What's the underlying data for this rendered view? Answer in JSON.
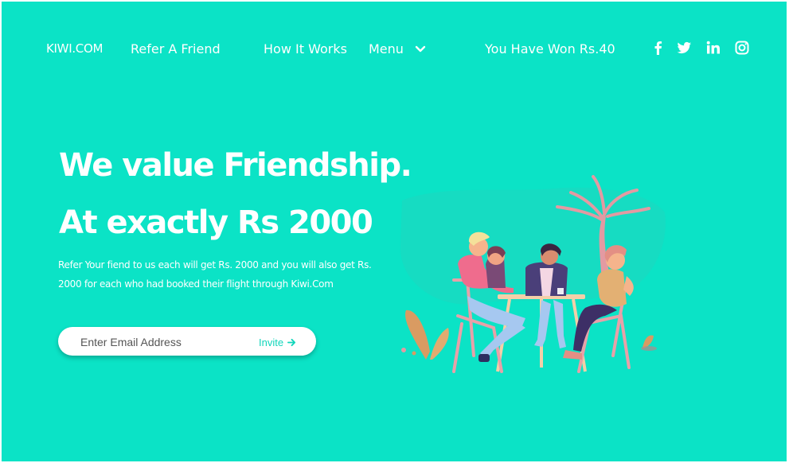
{
  "nav": {
    "brand": "KIWI.COM",
    "refer": "Refer A Friend",
    "how": "How It Works",
    "menu": "Menu",
    "won": "You Have Won Rs.40"
  },
  "social": [
    "facebook-icon",
    "twitter-icon",
    "linkedin-icon",
    "instagram-icon"
  ],
  "hero": {
    "line1": "We value Friendship.",
    "line2": "At exactly Rs 2000",
    "desc": "Refer Your fiend to us each will get Rs. 2000 and you will also get Rs. 2000 for each who had booked their flight through Kiwi.Com"
  },
  "invite": {
    "placeholder": "Enter Email Address",
    "button": "Invite"
  },
  "colors": {
    "background": "#0be3c6",
    "accent": "#12d6bb"
  }
}
